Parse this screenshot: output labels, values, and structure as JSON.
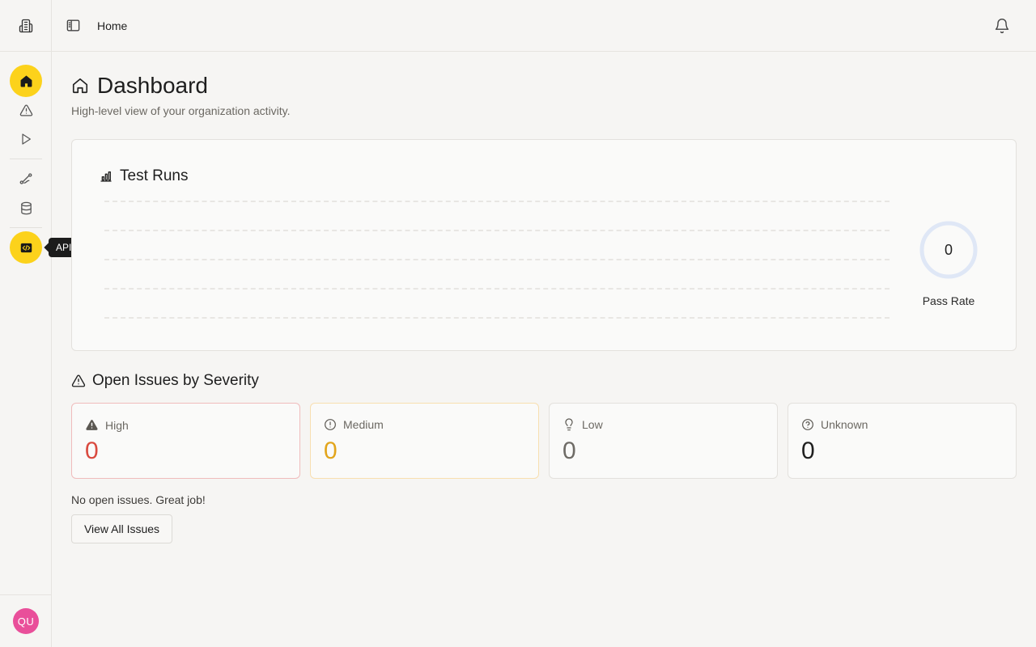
{
  "sidebar": {
    "logo_icon": "building-icon",
    "items": [
      {
        "name": "home",
        "icon": "home-icon",
        "active": true
      },
      {
        "name": "issues",
        "icon": "warning-icon",
        "active": false
      },
      {
        "name": "runs",
        "icon": "play-icon",
        "active": false
      },
      {
        "name": "workflows",
        "icon": "route-icon",
        "active": false
      },
      {
        "name": "data",
        "icon": "database-icon",
        "active": false
      },
      {
        "name": "api-catalog",
        "icon": "code-icon",
        "active": true
      }
    ],
    "tooltip": "API Catalog",
    "user_initials": "QU"
  },
  "topbar": {
    "breadcrumb": "Home"
  },
  "page": {
    "title": "Dashboard",
    "subtitle": "High-level view of your organization activity."
  },
  "test_runs": {
    "title": "Test Runs",
    "pass_rate_value": "0",
    "pass_rate_label": "Pass Rate"
  },
  "severity": {
    "title": "Open Issues by Severity",
    "cards": [
      {
        "label": "High",
        "count": "0",
        "color": "#d94a3f",
        "icon": "alert-triangle-icon"
      },
      {
        "label": "Medium",
        "count": "0",
        "color": "#e2a51c",
        "icon": "alert-circle-icon"
      },
      {
        "label": "Low",
        "count": "0",
        "color": "#6e6b66",
        "icon": "lightbulb-icon"
      },
      {
        "label": "Unknown",
        "count": "0",
        "color": "#1f1f1f",
        "icon": "help-circle-icon"
      }
    ],
    "empty_message": "No open issues. Great job!",
    "view_all_label": "View All Issues"
  },
  "colors": {
    "accent": "#fcd21b",
    "avatar": "#e94f9a",
    "gauge_ring": "#dfe7f6"
  }
}
